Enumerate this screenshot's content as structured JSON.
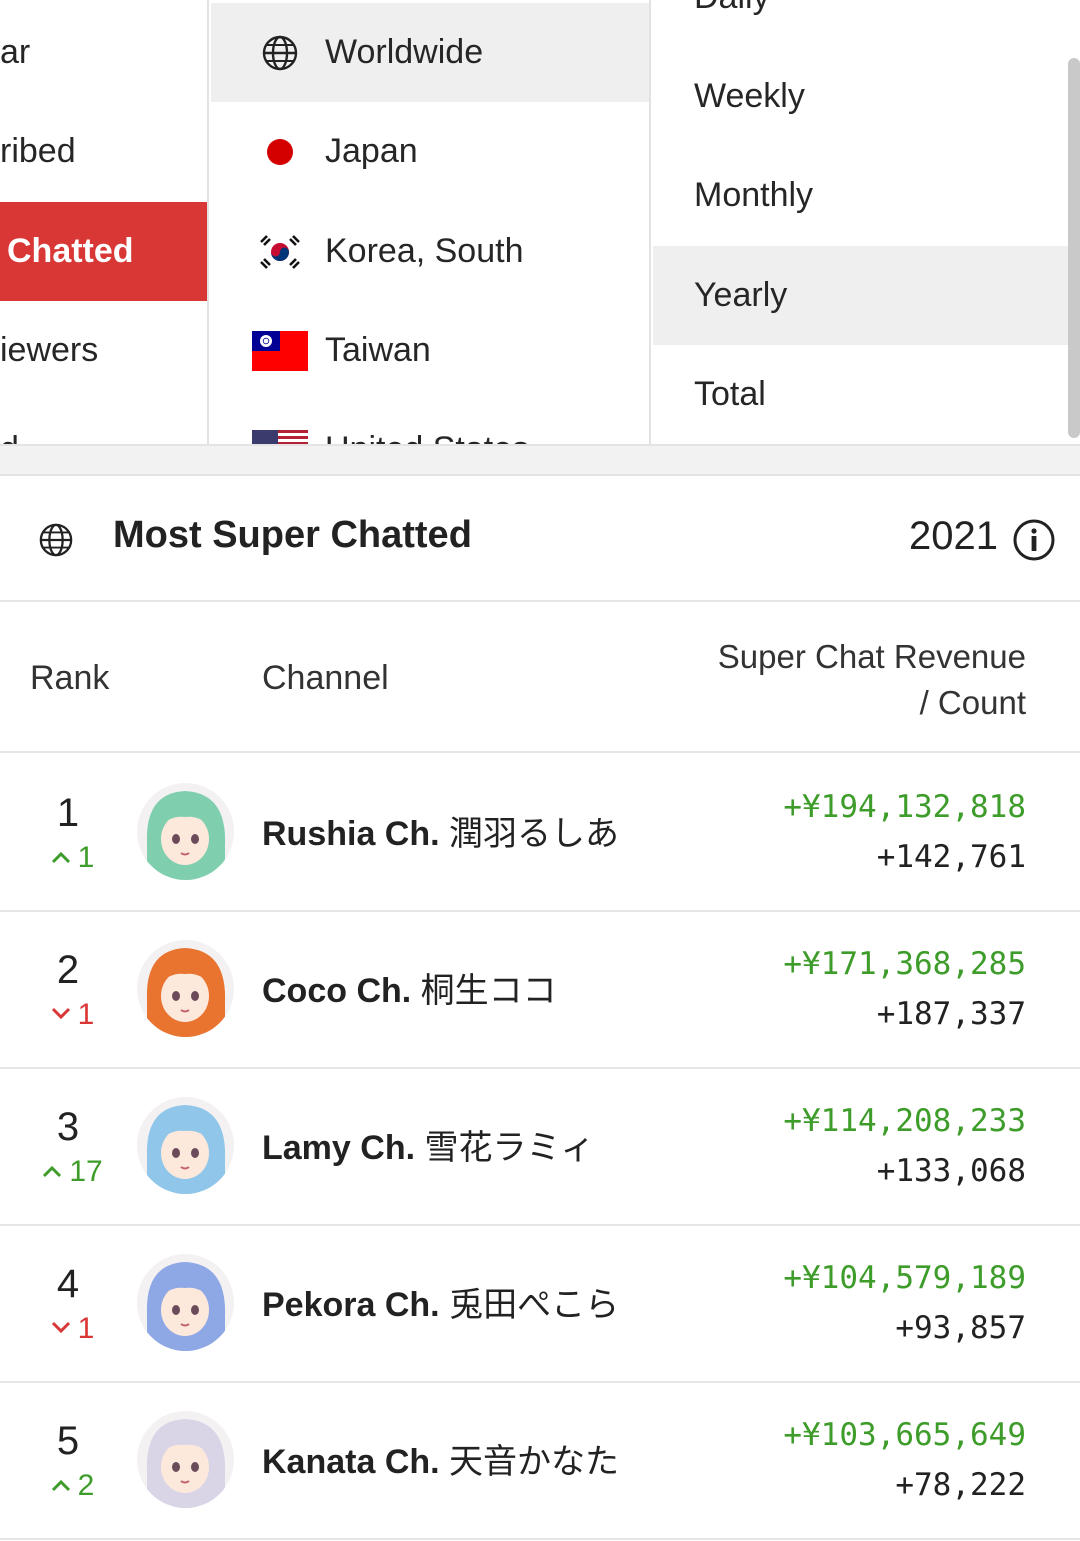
{
  "picker": {
    "metrics": [
      {
        "label": "ar"
      },
      {
        "label": "ribed"
      },
      {
        "label": "Chatted",
        "active": true
      },
      {
        "label": "iewers"
      },
      {
        "label": "d"
      }
    ],
    "regions": [
      {
        "label": "Worldwide",
        "icon": "globe-icon",
        "active": true
      },
      {
        "label": "Japan",
        "icon": "japan-flag-icon"
      },
      {
        "label": "Korea, South",
        "icon": "korea-flag-icon"
      },
      {
        "label": "Taiwan",
        "icon": "taiwan-flag-icon"
      },
      {
        "label": "United States",
        "icon": "us-flag-icon"
      }
    ],
    "periods": [
      {
        "label": "Daily"
      },
      {
        "label": "Weekly"
      },
      {
        "label": "Monthly"
      },
      {
        "label": "Yearly",
        "active": true
      },
      {
        "label": "Total"
      }
    ]
  },
  "section": {
    "title": "Most Super Chatted",
    "year": "2021",
    "region_icon": "globe-icon",
    "info_icon": "info-icon"
  },
  "table": {
    "headers": {
      "rank": "Rank",
      "channel": "Channel",
      "revenue_line1": "Super Chat Revenue",
      "revenue_line2": "/ Count"
    },
    "rows": [
      {
        "rank": "1",
        "delta": "1",
        "direction": "up",
        "name_en": "Rushia Ch.",
        "name_jp": "潤羽るしあ",
        "revenue": "+¥194,132,818",
        "count": "+142,761",
        "avatar_color": "#7fcfae"
      },
      {
        "rank": "2",
        "delta": "1",
        "direction": "down",
        "name_en": "Coco Ch.",
        "name_jp": "桐生ココ",
        "revenue": "+¥171,368,285",
        "count": "+187,337",
        "avatar_color": "#e8742f"
      },
      {
        "rank": "3",
        "delta": "17",
        "direction": "up",
        "name_en": "Lamy Ch.",
        "name_jp": "雪花ラミィ",
        "revenue": "+¥114,208,233",
        "count": "+133,068",
        "avatar_color": "#8fc6ea"
      },
      {
        "rank": "4",
        "delta": "1",
        "direction": "down",
        "name_en": "Pekora Ch.",
        "name_jp": "兎田ぺこら",
        "revenue": "+¥104,579,189",
        "count": "+93,857",
        "avatar_color": "#8ea8e6"
      },
      {
        "rank": "5",
        "delta": "2",
        "direction": "up",
        "name_en": "Kanata Ch.",
        "name_jp": "天音かなた",
        "revenue": "+¥103,665,649",
        "count": "+78,222",
        "avatar_color": "#d9d4e6"
      }
    ]
  },
  "colors": {
    "accent_red": "#d93636",
    "positive_green": "#3e9c2a",
    "selected_bg": "#efefef"
  }
}
